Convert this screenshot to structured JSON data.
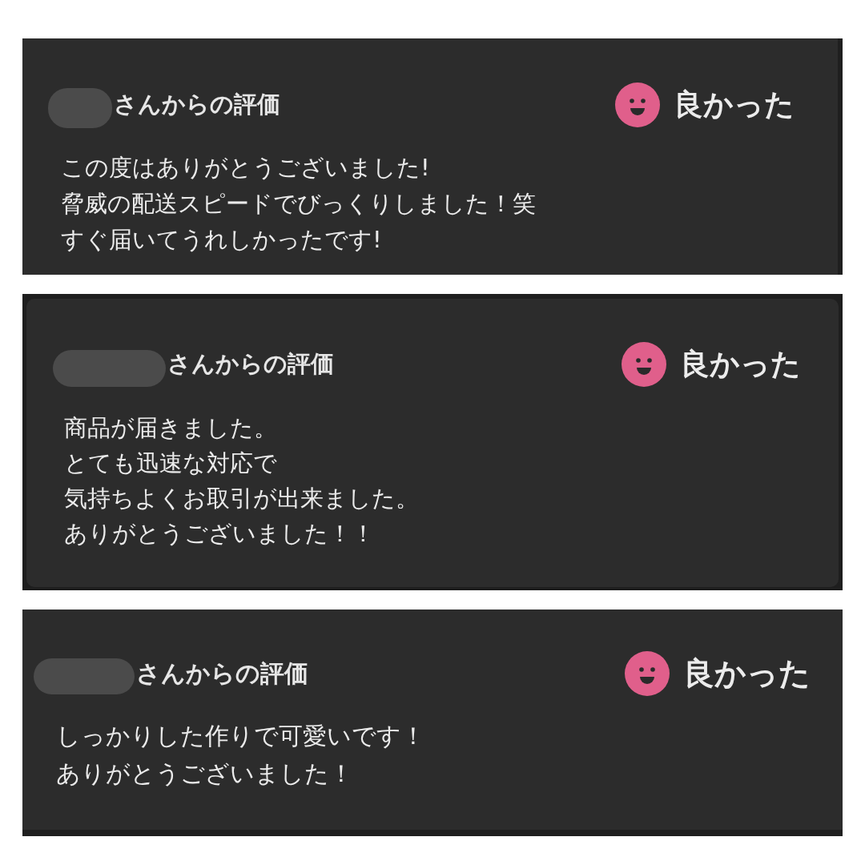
{
  "reviews": [
    {
      "title": "さんからの評価",
      "rating": {
        "kind": "good",
        "label": "良かった"
      },
      "comment_lines": [
        "この度はありがとうございました!",
        "脅威の配送スピードでびっくりしました！笑",
        "すぐ届いてうれしかったです!"
      ]
    },
    {
      "title": "さんからの評価",
      "rating": {
        "kind": "good",
        "label": "良かった"
      },
      "comment_lines": [
        "商品が届きました。",
        "とても迅速な対応で",
        "気持ちよくお取引が出来ました。",
        "ありがとうございました！！"
      ]
    },
    {
      "title": "さんからの評価",
      "rating": {
        "kind": "good",
        "label": "良かった"
      },
      "comment_lines": [
        "しっかりした作りで可愛いです！",
        "ありがとうございました！"
      ]
    }
  ]
}
